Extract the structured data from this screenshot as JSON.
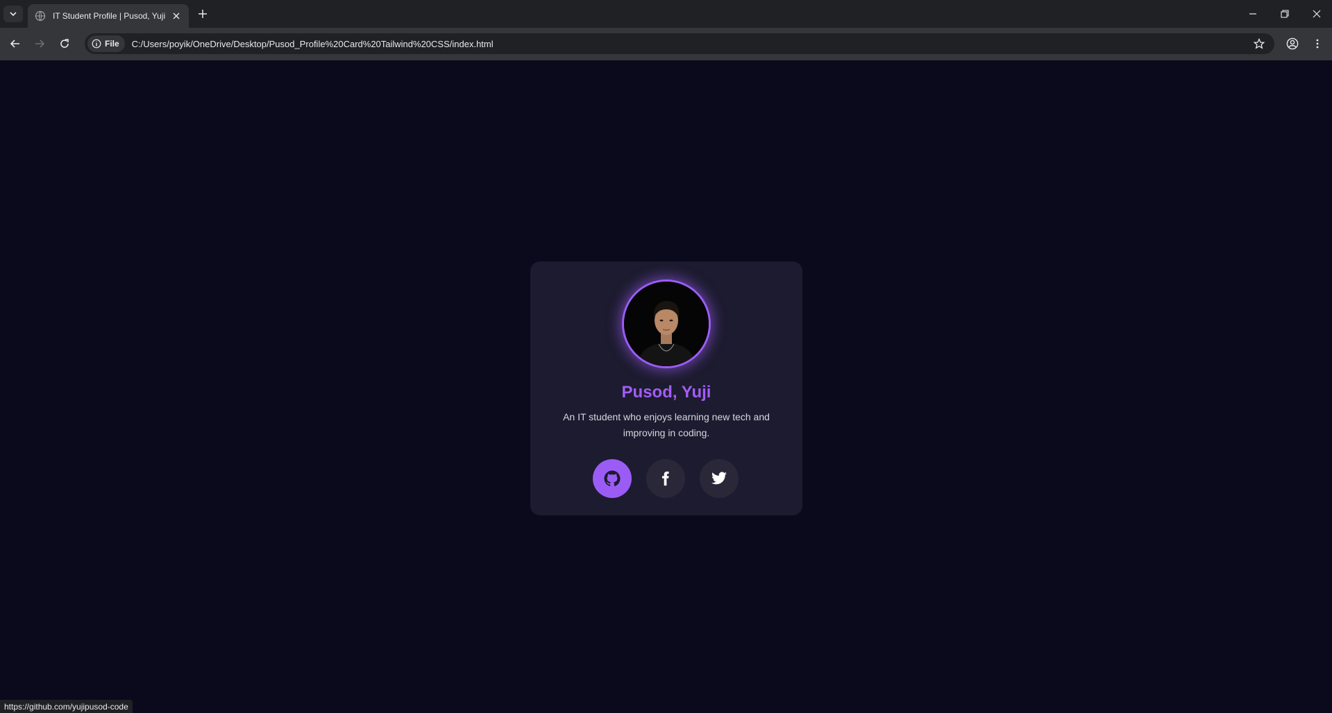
{
  "browser": {
    "tab": {
      "title": "IT Student Profile | Pusod, Yuji"
    },
    "omnibox": {
      "chip_label": "File",
      "url": "C:/Users/poyik/OneDrive/Desktop/Pusod_Profile%20Card%20Tailwind%20CSS/index.html"
    },
    "status_url": "https://github.com/yujipusod-code"
  },
  "profile": {
    "name": "Pusod, Yuji",
    "bio": "An IT student who enjoys learning new tech and improving in coding.",
    "socials": [
      {
        "icon": "github-icon",
        "active": true
      },
      {
        "icon": "facebook-icon",
        "active": false
      },
      {
        "icon": "twitter-icon",
        "active": false
      }
    ]
  },
  "colors": {
    "page_bg": "#0b0a1c",
    "card_bg": "#1d1b2f",
    "accent": "#9b5cf6",
    "name": "#a35cf7"
  }
}
